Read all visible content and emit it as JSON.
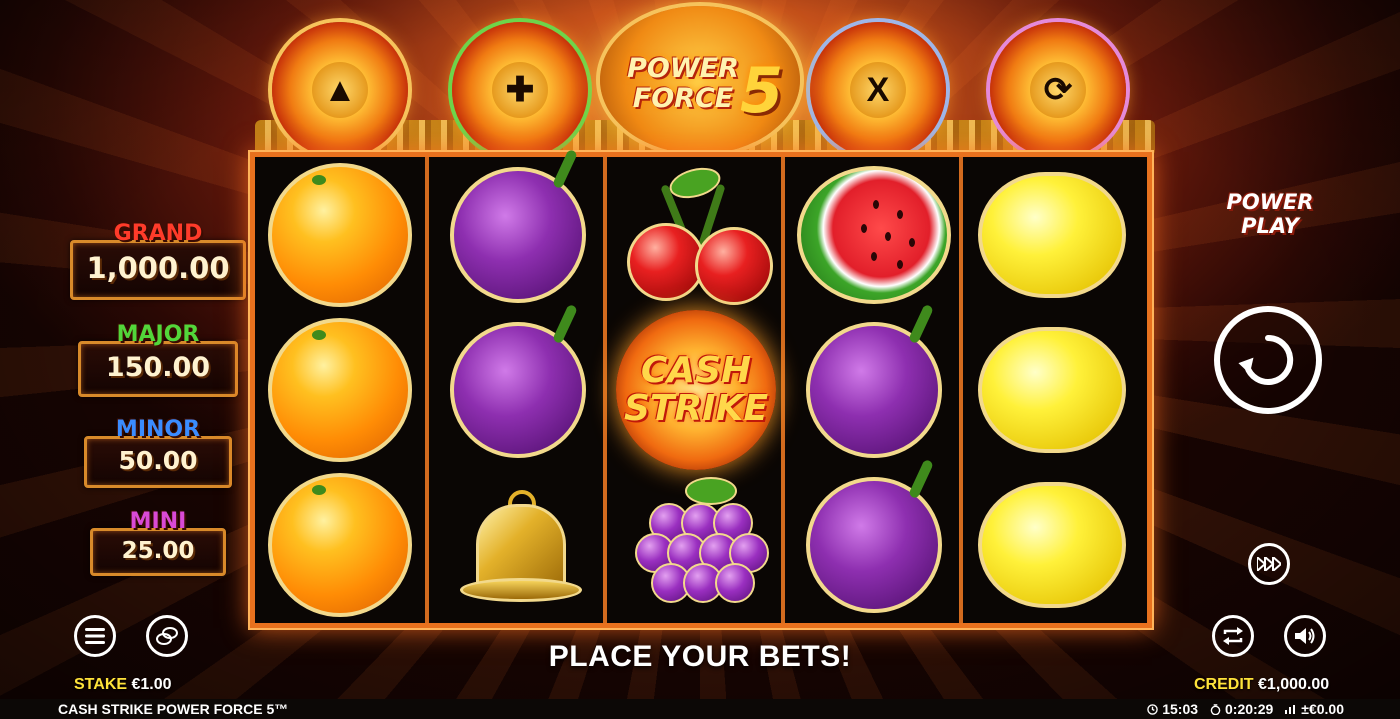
{
  "logo": {
    "line1": "POWER",
    "line2": "FORCE",
    "number": "5"
  },
  "feature_coins": [
    {
      "icon": "arrow-up-icon",
      "glyph": "▲",
      "ring": "gold"
    },
    {
      "icon": "plus-icon",
      "glyph": "✚",
      "ring": "green"
    },
    {
      "icon": "multiply-icon",
      "glyph": "X",
      "ring": "blue"
    },
    {
      "icon": "respin-icon",
      "glyph": "⟳",
      "ring": "pink"
    }
  ],
  "jackpots": [
    {
      "label": "GRAND",
      "value": "1,000.00",
      "color": "#ff3b2a"
    },
    {
      "label": "MAJOR",
      "value": "150.00",
      "color": "#52d63a"
    },
    {
      "label": "MINOR",
      "value": "50.00",
      "color": "#3a8cff"
    },
    {
      "label": "MINI",
      "value": "25.00",
      "color": "#d94ad6"
    }
  ],
  "reels": [
    [
      "orange",
      "orange",
      "orange"
    ],
    [
      "plum",
      "plum",
      "bell"
    ],
    [
      "cherries",
      "cash-strike",
      "grapes"
    ],
    [
      "watermelon",
      "plum",
      "plum"
    ],
    [
      "lemon",
      "lemon",
      "lemon"
    ]
  ],
  "cash_strike": {
    "line1": "CASH",
    "line2": "STRIKE"
  },
  "power_play": {
    "line1": "POWER",
    "line2": "PLAY"
  },
  "message": "PLACE YOUR BETS!",
  "stake": {
    "label": "STAKE",
    "value": "€1.00"
  },
  "credit": {
    "label": "CREDIT",
    "value": "€1,000.00"
  },
  "game_name": "CASH STRIKE POWER FORCE 5™",
  "status": {
    "clock": "15:03",
    "session_time": "0:20:29",
    "net": "±€0.00"
  }
}
